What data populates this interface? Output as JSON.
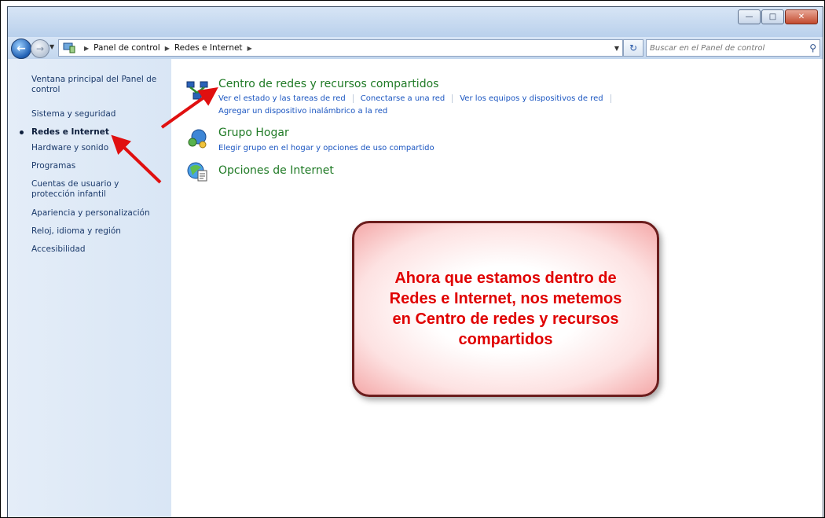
{
  "breadcrumb": {
    "items": [
      "Panel de control",
      "Redes e Internet"
    ]
  },
  "search": {
    "placeholder": "Buscar en el Panel de control"
  },
  "sidebar": {
    "items": [
      {
        "label": "Ventana principal del Panel de control"
      },
      {
        "label": "Sistema y seguridad"
      },
      {
        "label": "Redes e Internet",
        "active": true
      },
      {
        "label": "Hardware y sonido"
      },
      {
        "label": "Programas"
      },
      {
        "label": "Cuentas de usuario y protección infantil"
      },
      {
        "label": "Apariencia y personalización"
      },
      {
        "label": "Reloj, idioma y región"
      },
      {
        "label": "Accesibilidad"
      }
    ]
  },
  "categories": [
    {
      "title": "Centro de redes y recursos compartidos",
      "icon": "network-center-icon",
      "links": [
        "Ver el estado y las tareas de red",
        "Conectarse a una red",
        "Ver los equipos y dispositivos de red"
      ],
      "links2": [
        "Agregar un dispositivo inalámbrico a la red"
      ]
    },
    {
      "title": "Grupo Hogar",
      "icon": "homegroup-icon",
      "links": [
        "Elegir grupo en el hogar y opciones de uso compartido"
      ]
    },
    {
      "title": "Opciones de Internet",
      "icon": "internet-options-icon",
      "links": []
    }
  ],
  "callout": {
    "text": "Ahora que estamos dentro de Redes e Internet, nos metemos en Centro de redes y recursos compartidos"
  },
  "colors": {
    "link": "#1a55c0",
    "category_title": "#1f7a25",
    "callout_text": "#e00000",
    "arrow": "#e01010"
  }
}
